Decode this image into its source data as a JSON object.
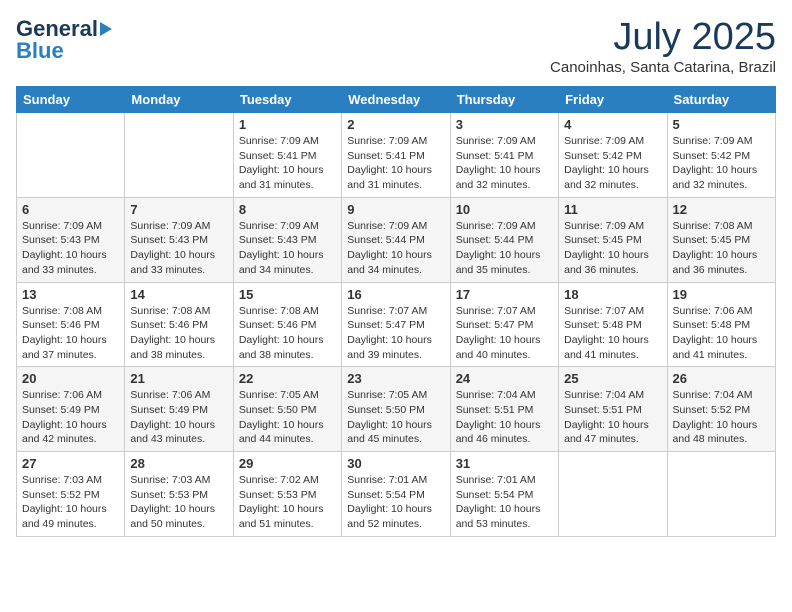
{
  "header": {
    "logo_general": "General",
    "logo_blue": "Blue",
    "month_title": "July 2025",
    "location": "Canoinhas, Santa Catarina, Brazil"
  },
  "days_of_week": [
    "Sunday",
    "Monday",
    "Tuesday",
    "Wednesday",
    "Thursday",
    "Friday",
    "Saturday"
  ],
  "weeks": [
    [
      {
        "day": "",
        "sunrise": "",
        "sunset": "",
        "daylight": ""
      },
      {
        "day": "",
        "sunrise": "",
        "sunset": "",
        "daylight": ""
      },
      {
        "day": "1",
        "sunrise": "Sunrise: 7:09 AM",
        "sunset": "Sunset: 5:41 PM",
        "daylight": "Daylight: 10 hours and 31 minutes."
      },
      {
        "day": "2",
        "sunrise": "Sunrise: 7:09 AM",
        "sunset": "Sunset: 5:41 PM",
        "daylight": "Daylight: 10 hours and 31 minutes."
      },
      {
        "day": "3",
        "sunrise": "Sunrise: 7:09 AM",
        "sunset": "Sunset: 5:41 PM",
        "daylight": "Daylight: 10 hours and 32 minutes."
      },
      {
        "day": "4",
        "sunrise": "Sunrise: 7:09 AM",
        "sunset": "Sunset: 5:42 PM",
        "daylight": "Daylight: 10 hours and 32 minutes."
      },
      {
        "day": "5",
        "sunrise": "Sunrise: 7:09 AM",
        "sunset": "Sunset: 5:42 PM",
        "daylight": "Daylight: 10 hours and 32 minutes."
      }
    ],
    [
      {
        "day": "6",
        "sunrise": "Sunrise: 7:09 AM",
        "sunset": "Sunset: 5:43 PM",
        "daylight": "Daylight: 10 hours and 33 minutes."
      },
      {
        "day": "7",
        "sunrise": "Sunrise: 7:09 AM",
        "sunset": "Sunset: 5:43 PM",
        "daylight": "Daylight: 10 hours and 33 minutes."
      },
      {
        "day": "8",
        "sunrise": "Sunrise: 7:09 AM",
        "sunset": "Sunset: 5:43 PM",
        "daylight": "Daylight: 10 hours and 34 minutes."
      },
      {
        "day": "9",
        "sunrise": "Sunrise: 7:09 AM",
        "sunset": "Sunset: 5:44 PM",
        "daylight": "Daylight: 10 hours and 34 minutes."
      },
      {
        "day": "10",
        "sunrise": "Sunrise: 7:09 AM",
        "sunset": "Sunset: 5:44 PM",
        "daylight": "Daylight: 10 hours and 35 minutes."
      },
      {
        "day": "11",
        "sunrise": "Sunrise: 7:09 AM",
        "sunset": "Sunset: 5:45 PM",
        "daylight": "Daylight: 10 hours and 36 minutes."
      },
      {
        "day": "12",
        "sunrise": "Sunrise: 7:08 AM",
        "sunset": "Sunset: 5:45 PM",
        "daylight": "Daylight: 10 hours and 36 minutes."
      }
    ],
    [
      {
        "day": "13",
        "sunrise": "Sunrise: 7:08 AM",
        "sunset": "Sunset: 5:46 PM",
        "daylight": "Daylight: 10 hours and 37 minutes."
      },
      {
        "day": "14",
        "sunrise": "Sunrise: 7:08 AM",
        "sunset": "Sunset: 5:46 PM",
        "daylight": "Daylight: 10 hours and 38 minutes."
      },
      {
        "day": "15",
        "sunrise": "Sunrise: 7:08 AM",
        "sunset": "Sunset: 5:46 PM",
        "daylight": "Daylight: 10 hours and 38 minutes."
      },
      {
        "day": "16",
        "sunrise": "Sunrise: 7:07 AM",
        "sunset": "Sunset: 5:47 PM",
        "daylight": "Daylight: 10 hours and 39 minutes."
      },
      {
        "day": "17",
        "sunrise": "Sunrise: 7:07 AM",
        "sunset": "Sunset: 5:47 PM",
        "daylight": "Daylight: 10 hours and 40 minutes."
      },
      {
        "day": "18",
        "sunrise": "Sunrise: 7:07 AM",
        "sunset": "Sunset: 5:48 PM",
        "daylight": "Daylight: 10 hours and 41 minutes."
      },
      {
        "day": "19",
        "sunrise": "Sunrise: 7:06 AM",
        "sunset": "Sunset: 5:48 PM",
        "daylight": "Daylight: 10 hours and 41 minutes."
      }
    ],
    [
      {
        "day": "20",
        "sunrise": "Sunrise: 7:06 AM",
        "sunset": "Sunset: 5:49 PM",
        "daylight": "Daylight: 10 hours and 42 minutes."
      },
      {
        "day": "21",
        "sunrise": "Sunrise: 7:06 AM",
        "sunset": "Sunset: 5:49 PM",
        "daylight": "Daylight: 10 hours and 43 minutes."
      },
      {
        "day": "22",
        "sunrise": "Sunrise: 7:05 AM",
        "sunset": "Sunset: 5:50 PM",
        "daylight": "Daylight: 10 hours and 44 minutes."
      },
      {
        "day": "23",
        "sunrise": "Sunrise: 7:05 AM",
        "sunset": "Sunset: 5:50 PM",
        "daylight": "Daylight: 10 hours and 45 minutes."
      },
      {
        "day": "24",
        "sunrise": "Sunrise: 7:04 AM",
        "sunset": "Sunset: 5:51 PM",
        "daylight": "Daylight: 10 hours and 46 minutes."
      },
      {
        "day": "25",
        "sunrise": "Sunrise: 7:04 AM",
        "sunset": "Sunset: 5:51 PM",
        "daylight": "Daylight: 10 hours and 47 minutes."
      },
      {
        "day": "26",
        "sunrise": "Sunrise: 7:04 AM",
        "sunset": "Sunset: 5:52 PM",
        "daylight": "Daylight: 10 hours and 48 minutes."
      }
    ],
    [
      {
        "day": "27",
        "sunrise": "Sunrise: 7:03 AM",
        "sunset": "Sunset: 5:52 PM",
        "daylight": "Daylight: 10 hours and 49 minutes."
      },
      {
        "day": "28",
        "sunrise": "Sunrise: 7:03 AM",
        "sunset": "Sunset: 5:53 PM",
        "daylight": "Daylight: 10 hours and 50 minutes."
      },
      {
        "day": "29",
        "sunrise": "Sunrise: 7:02 AM",
        "sunset": "Sunset: 5:53 PM",
        "daylight": "Daylight: 10 hours and 51 minutes."
      },
      {
        "day": "30",
        "sunrise": "Sunrise: 7:01 AM",
        "sunset": "Sunset: 5:54 PM",
        "daylight": "Daylight: 10 hours and 52 minutes."
      },
      {
        "day": "31",
        "sunrise": "Sunrise: 7:01 AM",
        "sunset": "Sunset: 5:54 PM",
        "daylight": "Daylight: 10 hours and 53 minutes."
      },
      {
        "day": "",
        "sunrise": "",
        "sunset": "",
        "daylight": ""
      },
      {
        "day": "",
        "sunrise": "",
        "sunset": "",
        "daylight": ""
      }
    ]
  ]
}
